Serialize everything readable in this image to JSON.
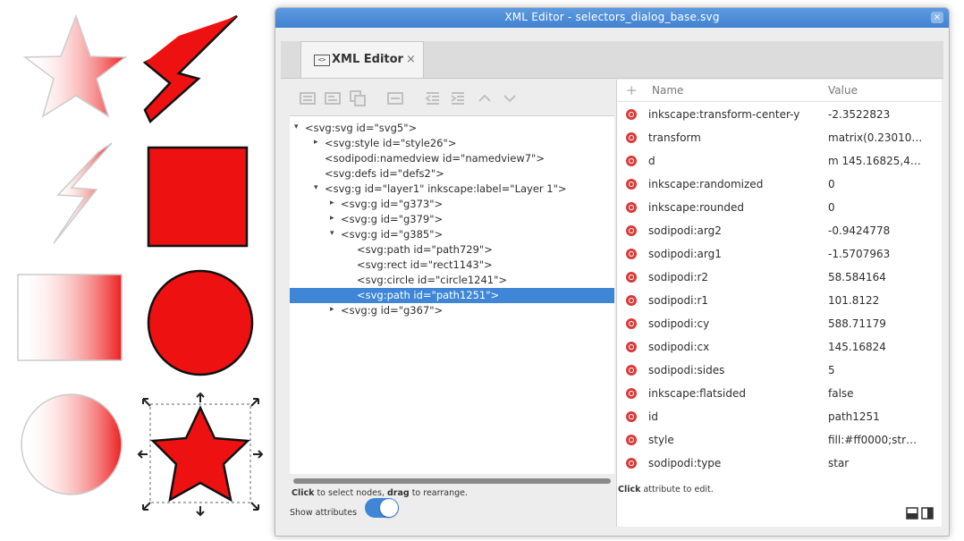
{
  "window": {
    "title": "XML Editor - selectors_dialog_base.svg",
    "close_glyph": "×"
  },
  "tab": {
    "label": "XML Editor",
    "close_glyph": "×",
    "icon": "xml-tag-icon",
    "icon_text": "<>"
  },
  "toolbar": {
    "buttons": [
      "new-element-node-icon",
      "new-text-node-icon",
      "duplicate-node-icon",
      "delete-node-icon",
      "unindent-node-icon",
      "indent-node-icon",
      "raise-node-icon",
      "lower-node-icon"
    ]
  },
  "tree": {
    "nodes": [
      {
        "arrow": "▾",
        "text": "<svg:svg id=\"svg5\">"
      },
      {
        "arrow": "▸",
        "text": "<svg:style id=\"style26\">"
      },
      {
        "arrow": "",
        "text": "<sodipodi:namedview id=\"namedview7\">"
      },
      {
        "arrow": "",
        "text": "<svg:defs id=\"defs2\">"
      },
      {
        "arrow": "▾",
        "text": "<svg:g id=\"layer1\" inkscape:label=\"Layer 1\">"
      },
      {
        "arrow": "▸",
        "text": "<svg:g id=\"g373\">"
      },
      {
        "arrow": "▸",
        "text": "<svg:g id=\"g379\">"
      },
      {
        "arrow": "▾",
        "text": "<svg:g id=\"g385\">"
      },
      {
        "arrow": "",
        "text": "<svg:path id=\"path729\">"
      },
      {
        "arrow": "",
        "text": "<svg:rect id=\"rect1143\">"
      },
      {
        "arrow": "",
        "text": "<svg:circle id=\"circle1241\">"
      },
      {
        "arrow": "",
        "text": "<svg:path id=\"path1251\">"
      },
      {
        "arrow": "▸",
        "text": "<svg:g id=\"g367\">"
      }
    ]
  },
  "left_hint": {
    "click": "Click",
    "rest1": " to select nodes, ",
    "drag": "drag",
    "rest2": " to rearrange."
  },
  "show_attributes": {
    "label": "Show attributes",
    "on": true
  },
  "attributes": {
    "header_plus": "+",
    "header_name": "Name",
    "header_value": "Value",
    "rows": [
      {
        "name": "inkscape:transform-center-y",
        "value": "-2.3522823"
      },
      {
        "name": "transform",
        "value": "matrix(0.23010…"
      },
      {
        "name": "d",
        "value": "m 145.16825,4…"
      },
      {
        "name": "inkscape:randomized",
        "value": "0"
      },
      {
        "name": "inkscape:rounded",
        "value": "0"
      },
      {
        "name": "sodipodi:arg2",
        "value": "-0.9424778"
      },
      {
        "name": "sodipodi:arg1",
        "value": "-1.5707963"
      },
      {
        "name": "sodipodi:r2",
        "value": "58.584164"
      },
      {
        "name": "sodipodi:r1",
        "value": "101.8122"
      },
      {
        "name": "sodipodi:cy",
        "value": "588.71179"
      },
      {
        "name": "sodipodi:cx",
        "value": "145.16824"
      },
      {
        "name": "sodipodi:sides",
        "value": "5"
      },
      {
        "name": "inkscape:flatsided",
        "value": "false"
      },
      {
        "name": "id",
        "value": "path1251"
      },
      {
        "name": "style",
        "value": "fill:#ff0000;str…"
      },
      {
        "name": "sodipodi:type",
        "value": "star"
      }
    ]
  },
  "right_hint": {
    "click": "Click",
    "rest": " attribute to edit."
  },
  "colors": {
    "accent": "#3f86d6",
    "shape_red": "#ee1111",
    "delete_red": "#d93a3a"
  }
}
